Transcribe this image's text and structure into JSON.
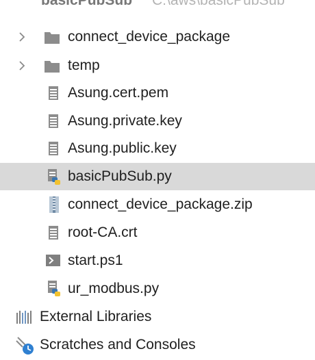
{
  "header": {
    "project_name": "basicPubSub",
    "project_path": "C:\\aws\\basicPubSub"
  },
  "tree": {
    "folders": [
      {
        "label": "connect_device_package",
        "icon": "folder-icon"
      },
      {
        "label": "temp",
        "icon": "folder-icon"
      }
    ],
    "files": [
      {
        "label": "Asung.cert.pem",
        "icon": "text-file-icon"
      },
      {
        "label": "Asung.private.key",
        "icon": "text-file-icon"
      },
      {
        "label": "Asung.public.key",
        "icon": "text-file-icon"
      },
      {
        "label": "basicPubSub.py",
        "icon": "python-file-icon",
        "selected": true
      },
      {
        "label": "connect_device_package.zip",
        "icon": "zip-file-icon"
      },
      {
        "label": "root-CA.crt",
        "icon": "text-file-icon"
      },
      {
        "label": "start.ps1",
        "icon": "powershell-file-icon"
      },
      {
        "label": "ur_modbus.py",
        "icon": "python-file-icon"
      }
    ],
    "roots": [
      {
        "label": "External Libraries",
        "icon": "library-icon"
      },
      {
        "label": "Scratches and Consoles",
        "icon": "scratches-icon"
      }
    ]
  },
  "colors": {
    "selection": "#d9d9d9",
    "folder": "#8c8c8c",
    "python_blue": "#3a75b0",
    "python_yellow": "#f2c230"
  }
}
